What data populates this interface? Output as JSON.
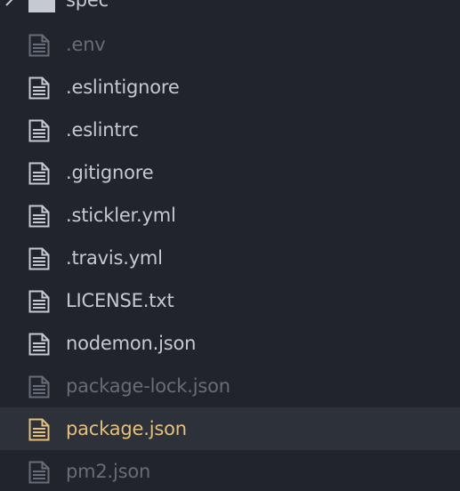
{
  "colors": {
    "background": "#21252b",
    "selected_row": "#2c313a",
    "text_normal": "#c4c9d2",
    "text_ignored": "#666d78",
    "text_modified": "#e5c07b"
  },
  "folder": {
    "label": "spec",
    "icon": "folder-icon",
    "expand_icon": "chevron-right-icon"
  },
  "files": [
    {
      "label": ".env",
      "status": "ignored",
      "icon": "file-text-icon"
    },
    {
      "label": ".eslintignore",
      "status": "normal",
      "icon": "file-text-icon"
    },
    {
      "label": ".eslintrc",
      "status": "normal",
      "icon": "file-text-icon"
    },
    {
      "label": ".gitignore",
      "status": "normal",
      "icon": "file-text-icon"
    },
    {
      "label": ".stickler.yml",
      "status": "normal",
      "icon": "file-text-icon"
    },
    {
      "label": ".travis.yml",
      "status": "normal",
      "icon": "file-text-icon"
    },
    {
      "label": "LICENSE.txt",
      "status": "normal",
      "icon": "file-text-icon"
    },
    {
      "label": "nodemon.json",
      "status": "normal",
      "icon": "file-text-icon"
    },
    {
      "label": "package-lock.json",
      "status": "ignored",
      "icon": "file-text-icon"
    },
    {
      "label": "package.json",
      "status": "modified",
      "selected": true,
      "icon": "file-text-icon"
    },
    {
      "label": "pm2.json",
      "status": "ignored",
      "icon": "file-text-icon"
    }
  ]
}
